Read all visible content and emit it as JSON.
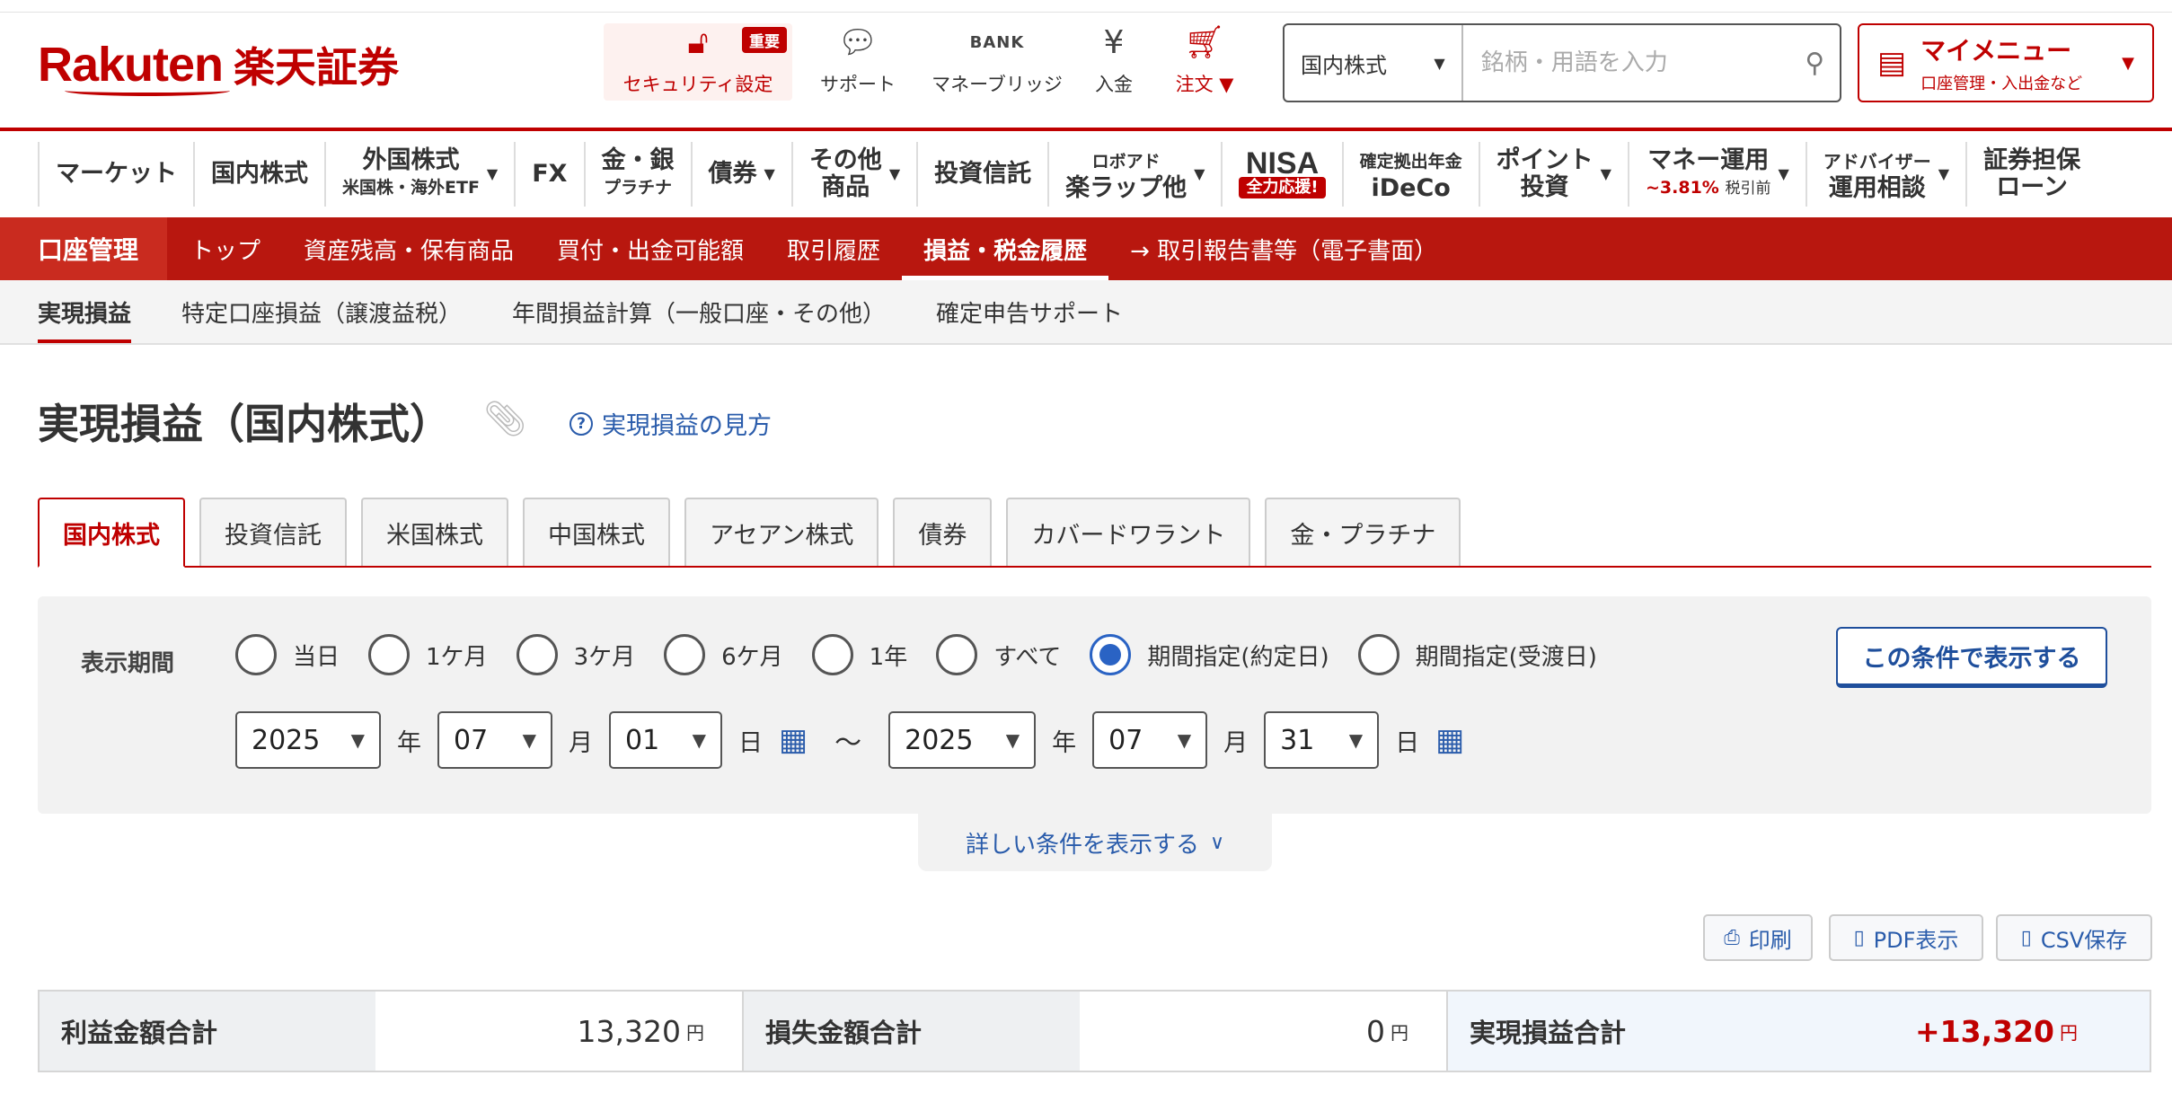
{
  "header": {
    "logo_en": "Rakuten",
    "logo_jp": "楽天証券",
    "security": {
      "label": "セキュリティ設定",
      "badge": "重要"
    },
    "support": "サポート",
    "money_bridge": {
      "label": "マネーブリッジ",
      "icon_text": "BANK"
    },
    "deposit": "入金",
    "order": "注文 ▼",
    "search": {
      "category": "国内株式",
      "placeholder": "銘柄・用語を入力"
    },
    "mymenu": {
      "title": "マイメニュー",
      "subtitle": "口座管理・入出金など"
    }
  },
  "global_nav": [
    {
      "label": "マーケット"
    },
    {
      "label": "国内株式"
    },
    {
      "label": "外国株式",
      "sub": "米国株・海外ETF",
      "arrow": true
    },
    {
      "label": "FX"
    },
    {
      "label": "金・銀",
      "sub": "プラチナ"
    },
    {
      "label": "債券",
      "arrow": true
    },
    {
      "label": "その他",
      "sub": "商品",
      "arrow": true
    },
    {
      "label": "投資信託"
    },
    {
      "label": "ロボアド",
      "sub": "楽ラップ他",
      "arrow": true
    },
    {
      "label": "NISA",
      "badge": "全力応援!"
    },
    {
      "label": "確定拠出年金",
      "sub": "iDeCo"
    },
    {
      "label": "ポイント",
      "sub": "投資",
      "arrow": true
    },
    {
      "label": "マネー運用",
      "sub_red": "~3.81%",
      "sub": "税引前",
      "arrow": true
    },
    {
      "label": "アドバイザー",
      "sub": "運用相談",
      "arrow": true
    },
    {
      "label": "証券担保",
      "sub": "ローン"
    }
  ],
  "account_bar": {
    "title": "口座管理",
    "items": [
      "トップ",
      "資産残高・保有商品",
      "買付・出金可能額",
      "取引履歴",
      "損益・税金履歴",
      "→ 取引報告書等（電子書面）"
    ],
    "active_index": 4
  },
  "sub_tabs": {
    "items": [
      "実現損益",
      "特定口座損益（譲渡益税）",
      "年間損益計算（一般口座・その他）",
      "確定申告サポート"
    ],
    "active_index": 0
  },
  "page": {
    "title": "実現損益（国内株式）",
    "help_link": "実現損益の見方"
  },
  "product_tabs": {
    "items": [
      "国内株式",
      "投資信託",
      "米国株式",
      "中国株式",
      "アセアン株式",
      "債券",
      "カバードワラント",
      "金・プラチナ"
    ],
    "active_index": 0
  },
  "filter": {
    "label": "表示期間",
    "options": [
      "当日",
      "1ケ月",
      "3ケ月",
      "6ケ月",
      "1年",
      "すべて",
      "期間指定(約定日)",
      "期間指定(受渡日)"
    ],
    "selected_index": 6,
    "apply_button": "この条件で表示する",
    "from": {
      "year": "2025",
      "month": "07",
      "day": "01"
    },
    "to": {
      "year": "2025",
      "month": "07",
      "day": "31"
    },
    "units": {
      "year": "年",
      "month": "月",
      "day": "日"
    },
    "separator": "〜",
    "more_conditions": "詳しい条件を表示する"
  },
  "actions": {
    "print": "印刷",
    "pdf": "PDF表示",
    "csv": "CSV保存"
  },
  "summary": {
    "profit_label": "利益金額合計",
    "profit_value": "13,320",
    "loss_label": "損失金額合計",
    "loss_value": "0",
    "total_label": "実現損益合計",
    "total_value": "+13,320",
    "currency": "円"
  },
  "colors": {
    "brand": "#bf0000",
    "link": "#2a5cab",
    "radio": "#2a63c4"
  }
}
